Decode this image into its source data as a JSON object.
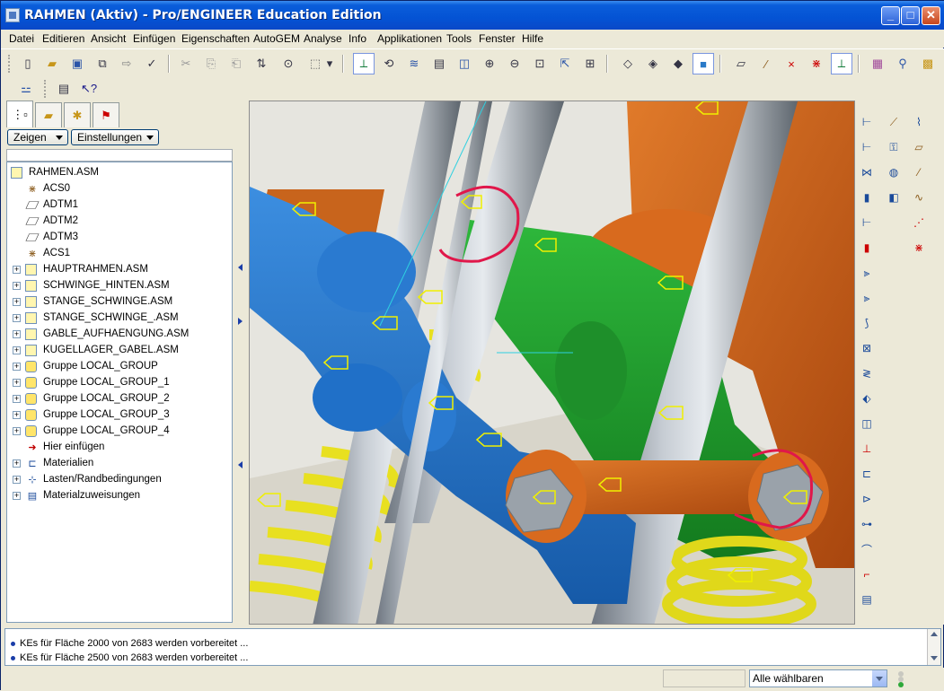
{
  "window": {
    "title": "RAHMEN (Aktiv) - Pro/ENGINEER Education Edition",
    "minimize": "_",
    "maximize": "□",
    "close": "✕"
  },
  "menu": [
    "Datei",
    "Editieren",
    "Ansicht",
    "Einfügen",
    "Eigenschaften",
    "AutoGEM",
    "Analyse",
    "Info",
    "Applikationen",
    "Tools",
    "Fenster",
    "Hilfe"
  ],
  "left_panel": {
    "buttons": {
      "show": "Zeigen",
      "settings": "Einstellungen"
    },
    "tree": [
      {
        "label": "RAHMEN.ASM",
        "icon": "assembly-icon",
        "expandable": false,
        "indent": 0
      },
      {
        "label": "ACS0",
        "icon": "csys-icon",
        "expandable": false,
        "indent": 1
      },
      {
        "label": "ADTM1",
        "icon": "datum-plane-icon",
        "expandable": false,
        "indent": 1
      },
      {
        "label": "ADTM2",
        "icon": "datum-plane-icon",
        "expandable": false,
        "indent": 1
      },
      {
        "label": "ADTM3",
        "icon": "datum-plane-icon",
        "expandable": false,
        "indent": 1
      },
      {
        "label": "ACS1",
        "icon": "csys-icon",
        "expandable": false,
        "indent": 1
      },
      {
        "label": "HAUPTRAHMEN.ASM",
        "icon": "assembly-icon",
        "expandable": true,
        "indent": 1
      },
      {
        "label": "SCHWINGE_HINTEN.ASM",
        "icon": "assembly-icon",
        "expandable": true,
        "indent": 1
      },
      {
        "label": "STANGE_SCHWINGE.ASM",
        "icon": "assembly-icon",
        "expandable": true,
        "indent": 1
      },
      {
        "label": "STANGE_SCHWINGE_.ASM",
        "icon": "assembly-icon",
        "expandable": true,
        "indent": 1
      },
      {
        "label": "GABLE_AUFHAENGUNG.ASM",
        "icon": "assembly-icon",
        "expandable": true,
        "indent": 1
      },
      {
        "label": "KUGELLAGER_GABEL.ASM",
        "icon": "assembly-icon",
        "expandable": true,
        "indent": 1
      },
      {
        "label": "Gruppe LOCAL_GROUP",
        "icon": "group-icon",
        "expandable": true,
        "indent": 1
      },
      {
        "label": "Gruppe LOCAL_GROUP_1",
        "icon": "group-icon",
        "expandable": true,
        "indent": 1
      },
      {
        "label": "Gruppe LOCAL_GROUP_2",
        "icon": "group-icon",
        "expandable": true,
        "indent": 1
      },
      {
        "label": "Gruppe LOCAL_GROUP_3",
        "icon": "group-icon",
        "expandable": true,
        "indent": 1
      },
      {
        "label": "Gruppe LOCAL_GROUP_4",
        "icon": "group-icon",
        "expandable": true,
        "indent": 1
      },
      {
        "label": "Hier einfügen",
        "icon": "insert-here-arrow-icon",
        "expandable": false,
        "indent": 1
      },
      {
        "label": "Materialien",
        "icon": "materials-icon",
        "expandable": true,
        "indent": 1
      },
      {
        "label": "Lasten/Randbedingungen",
        "icon": "loads-constraints-icon",
        "expandable": true,
        "indent": 1
      },
      {
        "label": "Materialzuweisungen",
        "icon": "material-assignment-icon",
        "expandable": true,
        "indent": 1
      }
    ]
  },
  "messages": [
    "KEs für Fläche 2000 von 2683 werden vorbereitet ...",
    "KEs für Fläche 2500 von 2683 werden vorbereitet ..."
  ],
  "status": {
    "selection_filter": "Alle wählbaren"
  },
  "colors": {
    "title_bar": "#0453D4",
    "frame_gray": "#A8A8A8",
    "arm_blue": "#1F6FC4",
    "link_orange": "#C85A12",
    "mount_green": "#1E9B2A",
    "spring_yellow": "#E8E020",
    "highlight_red": "#E0174A",
    "tag_yellow": "#F0F000"
  }
}
